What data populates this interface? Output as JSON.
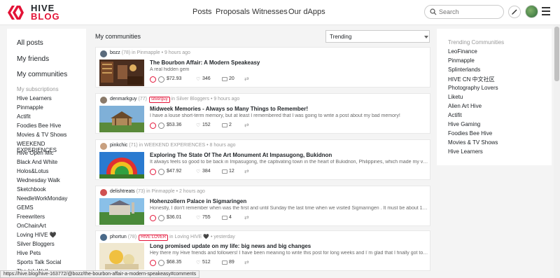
{
  "header": {
    "logo_hive": "HIVE",
    "logo_blog": "BLOG",
    "nav": [
      "Posts",
      "Proposals",
      "Witnesses",
      "Our dApps"
    ],
    "search_placeholder": "Search"
  },
  "left": {
    "main_links": [
      "All posts",
      "My friends",
      "My communities"
    ],
    "subscriptions_title": "My subscriptions",
    "subscriptions": [
      "Hive Learners",
      "Pinmapple",
      "Actifit",
      "Foodies Bee Hive",
      "Movies & TV Shows",
      "WEEKEND EXPERIENCES",
      "Hive Open Mic",
      "Black And White",
      "Holos&Lotus",
      "Wednesday Walk",
      "Sketchbook",
      "NeedleWorkMonday",
      "GEMS",
      "Freewriters",
      "OnChainArt",
      "Loving HIVE 🖤",
      "Silver Bloggers",
      "Hive Pets",
      "Sports Talk Social",
      "The Ink Well"
    ]
  },
  "main": {
    "title": "My communities",
    "sort_value": "Trending",
    "posts": [
      {
        "author": "bozz",
        "rep": "(78)",
        "tag": "",
        "community_prefix": " in ",
        "community": "Pinmapple",
        "time": " • 9 hours ago",
        "title": "The Bourbon Affair: A Modern Speakeasy",
        "desc": "A real hidden gem",
        "payout": "$72.93",
        "likes": "346",
        "comments": "20"
      },
      {
        "author": "denmarkguy",
        "rep": "(77)",
        "tag": "silverguy",
        "community_prefix": " in ",
        "community": "Silver Bloggers",
        "time": " • 9 hours ago",
        "title": "Midweek Memories - Always so Many Things to Remember!",
        "desc": "I have a louse short-term memory, but at least I remembered that I was going to write a post about my bad memory!",
        "payout": "$53.36",
        "likes": "152",
        "comments": "2"
      },
      {
        "author": "pinkchic",
        "rep": "(71)",
        "tag": "",
        "community_prefix": " in ",
        "community": "WEEKEND EXPERIENCES",
        "time": " • 8 hours ago",
        "title": "Exploring The State Of The Art Monument At Impasugong, Bukidnon",
        "desc": "It always feels so good to be back in Impasugong, the captivating town in the heart of Bukidnon, Philippines, which made my visit ...",
        "payout": "$47.92",
        "likes": "384",
        "comments": "12"
      },
      {
        "author": "delishtreats",
        "rep": "(73)",
        "tag": "",
        "community_prefix": " in ",
        "community": "Pinmapple",
        "time": " • 2 hours ago",
        "title": "Hohenzollern Palace in Sigmaringen",
        "desc": "Honestly, I don't remember when was the first and until Sunday the last time when we visited Sigmaringen . It must be about 10 ye...",
        "payout": "$36.01",
        "likes": "755",
        "comments": "4"
      },
      {
        "author": "phortun",
        "rep": "(78)",
        "tag": "HIVE LOVER",
        "community_prefix": " in ",
        "community": "Loving HIVE 🖤",
        "time": " • yesterday",
        "title": "Long promised update on my life: big news and big changes",
        "desc": "Hey there my Hive friends and followers! I have been meaning to write this post for long weeks and I`m glad that I finally got to do i...",
        "payout": "$68.35",
        "likes": "512",
        "comments": "89"
      }
    ]
  },
  "right": {
    "title": "Trending Communities",
    "items": [
      "LeoFinance",
      "Pinmapple",
      "Splinterlands",
      "HIVE CN 中文社区",
      "Photography Lovers",
      "Liketu",
      "Alien Art Hive",
      "Actifit",
      "Hive Gaming",
      "Foodies Bee Hive",
      "Movies & TV Shows",
      "Hive Learners"
    ]
  },
  "status_url": "https://hive.blog/hive-163772/@bozz/the-bourbon-affair-a-modern-speakeasy#comments",
  "colors": {
    "brand": "#e31337"
  }
}
